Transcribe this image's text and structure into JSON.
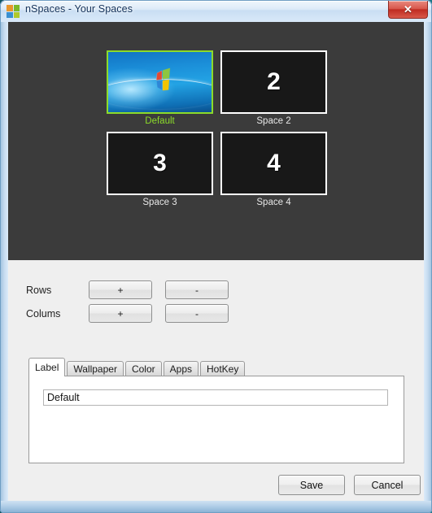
{
  "window": {
    "title": "nSpaces - Your Spaces",
    "icon_name": "nspaces-app-icon",
    "icon_colors": [
      "#e8962c",
      "#7ab929",
      "#3a8fd0",
      "#b0c92a"
    ],
    "close_label": "✕"
  },
  "spaces": {
    "selected_index": 0,
    "items": [
      {
        "thumb_text": "",
        "label": "Default",
        "selected": true,
        "wallpaper": "windows7-default"
      },
      {
        "thumb_text": "2",
        "label": "Space 2",
        "selected": false,
        "wallpaper": ""
      },
      {
        "thumb_text": "3",
        "label": "Space 3",
        "selected": false,
        "wallpaper": ""
      },
      {
        "thumb_text": "4",
        "label": "Space 4",
        "selected": false,
        "wallpaper": ""
      }
    ],
    "highlight_color": "#8cdb2a",
    "panel_background": "#3b3b3b"
  },
  "grid_controls": {
    "rows_label": "Rows",
    "rows_plus": "+",
    "rows_minus": "-",
    "columns_label": "Colums",
    "columns_plus": "+",
    "columns_minus": "-"
  },
  "tabs": {
    "active": "Label",
    "items": [
      {
        "label": "Label"
      },
      {
        "label": "Wallpaper"
      },
      {
        "label": "Color"
      },
      {
        "label": "Apps"
      },
      {
        "label": "HotKey"
      }
    ]
  },
  "label_tab": {
    "input_value": "Default",
    "input_placeholder": ""
  },
  "footer": {
    "save_label": "Save",
    "cancel_label": "Cancel"
  }
}
